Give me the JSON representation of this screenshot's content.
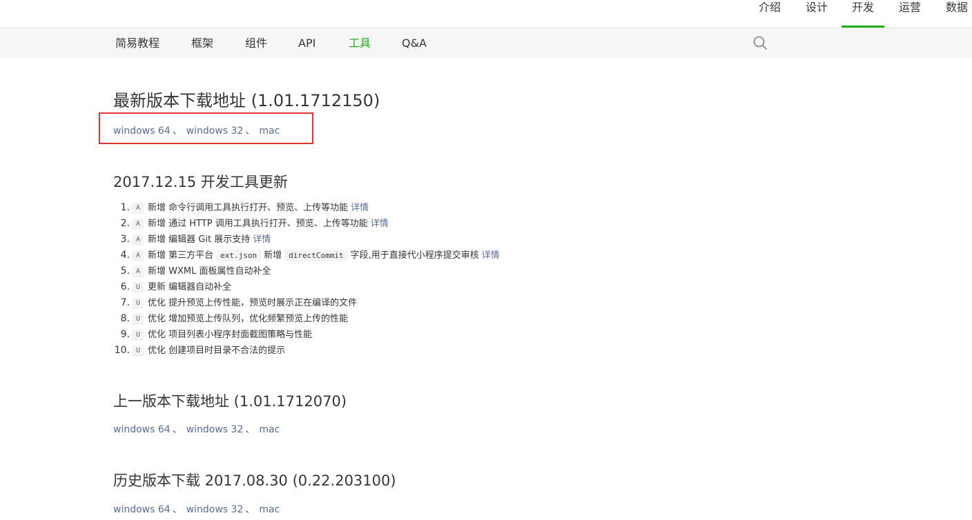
{
  "topnav": {
    "items": [
      {
        "label": "介绍"
      },
      {
        "label": "设计"
      },
      {
        "label": "开发"
      },
      {
        "label": "运营"
      },
      {
        "label": "数据"
      }
    ]
  },
  "subnav": {
    "items": [
      {
        "label": "简易教程"
      },
      {
        "label": "框架"
      },
      {
        "label": "组件"
      },
      {
        "label": "API"
      },
      {
        "label": "工具"
      },
      {
        "label": "Q&A"
      }
    ],
    "search_icon": "search-icon"
  },
  "colors": {
    "accent": "#1aad19",
    "link": "#576b95",
    "highlight_border": "#e53333"
  },
  "latest": {
    "title": "最新版本下载地址 (1.01.1712150)",
    "links": [
      "windows 64",
      "windows 32",
      "mac"
    ],
    "separator": "、"
  },
  "changelog": {
    "title": "2017.12.15 开发工具更新",
    "items": [
      {
        "num": "1.",
        "tag": "A",
        "text": "新增 命令行调用工具执行打开、预览、上传等功能",
        "detail": "详情"
      },
      {
        "num": "2.",
        "tag": "A",
        "text": "新增 通过 HTTP 调用工具执行打开、预览、上传等功能",
        "detail": "详情"
      },
      {
        "num": "3.",
        "tag": "A",
        "text": "新增 编辑器 Git 展示支持",
        "detail": "详情"
      },
      {
        "num": "4.",
        "tag": "A",
        "text_before": "新增 第三方平台",
        "code1": "ext.json",
        "text_mid": "新增",
        "code2": "directCommit",
        "text_after": "字段,用于直接代小程序提交审核",
        "detail": "详情"
      },
      {
        "num": "5.",
        "tag": "A",
        "text": "新增 WXML 面板属性自动补全"
      },
      {
        "num": "6.",
        "tag": "U",
        "text": "更新 编辑器自动补全"
      },
      {
        "num": "7.",
        "tag": "U",
        "text": "优化 提升预览上传性能，预览时展示正在编译的文件"
      },
      {
        "num": "8.",
        "tag": "U",
        "text": "优化 增加预览上传队列，优化频繁预览上传的性能"
      },
      {
        "num": "9.",
        "tag": "U",
        "text": "优化 项目列表小程序封面截图策略与性能"
      },
      {
        "num": "10.",
        "tag": "U",
        "text": "优化 创建项目时目录不合法的提示"
      }
    ]
  },
  "previous": {
    "title": "上一版本下载地址 (1.01.1712070)",
    "links": [
      "windows 64",
      "windows 32",
      "mac"
    ]
  },
  "history": {
    "title": "历史版本下载 2017.08.30 (0.22.203100)",
    "links": [
      "windows 64",
      "windows 32",
      "mac"
    ]
  }
}
